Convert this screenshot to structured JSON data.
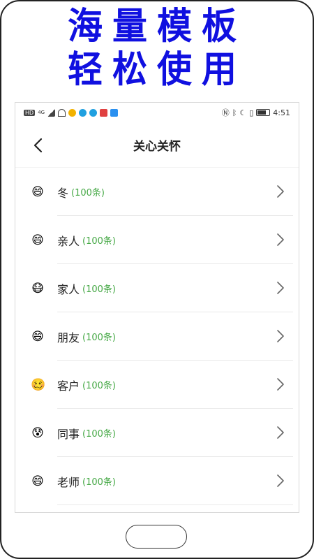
{
  "promo": {
    "line1": "海量模板",
    "line2": "轻松使用",
    "color": "#1010e0"
  },
  "statusbar": {
    "time": "4:51",
    "hd": "HD",
    "network": "4G"
  },
  "header": {
    "title": "关心关怀",
    "back_icon": "chevron-left-icon"
  },
  "categories": [
    {
      "emoji": "😄",
      "name": "冬",
      "count": "(100条)"
    },
    {
      "emoji": "😄",
      "name": "亲人",
      "count": "(100条)"
    },
    {
      "emoji": "😷",
      "name": "家人",
      "count": "(100条)"
    },
    {
      "emoji": "😄",
      "name": "朋友",
      "count": "(100条)"
    },
    {
      "emoji": "🥴",
      "name": "客户",
      "count": "(100条)"
    },
    {
      "emoji": "😰",
      "name": "同事",
      "count": "(100条)"
    },
    {
      "emoji": "😄",
      "name": "老师",
      "count": "(100条)"
    }
  ],
  "colors": {
    "count_green": "#45a845",
    "divider": "#e9e9e9"
  }
}
